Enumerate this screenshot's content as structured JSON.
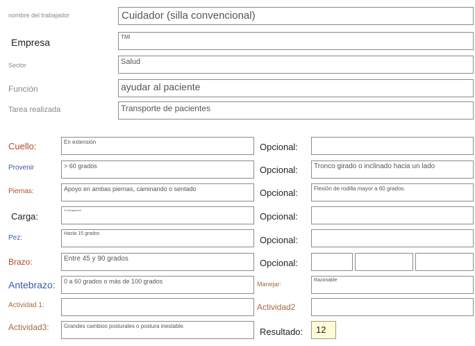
{
  "header": {
    "nombre": {
      "label": "nombre del trabajador",
      "value": "Cuidador (silla convencional)"
    },
    "empresa": {
      "label": "Empresa",
      "value": "TMI"
    },
    "sector": {
      "label": "Sector",
      "value": "Salud"
    },
    "funcion": {
      "label": "Función",
      "value": "ayudar al paciente"
    },
    "tarea": {
      "label": "Tarea realizada",
      "value": "Transporte de pacientes"
    }
  },
  "rows": {
    "cuello": {
      "label": "Cuello:",
      "value": "En extensión",
      "opt_label": "Opcional:",
      "opt_value": ""
    },
    "provenir": {
      "label": "Provenir",
      "value": "> 60 grados",
      "opt_label": "Opcional:",
      "opt_value": "Tronco girado o inclinado hacia un lado"
    },
    "piernas": {
      "label": "Piernas:",
      "value": "Apoyo en ambas piernas, caminando o sentado",
      "opt_label": "Opcional:",
      "opt_value": "Flexión de rodilla mayor a 60 grados."
    },
    "carga": {
      "label": "Carga:",
      "value": "10 kilogramos",
      "opt_label": "Opcional:",
      "opt_value": ""
    },
    "pez": {
      "label": "Pez:",
      "value": "Hasta 15 grados",
      "opt_label": "Opcional:",
      "opt_value": ""
    },
    "brazo": {
      "label": "Brazo:",
      "value": "Entre 45 y 90 grados",
      "opt_label": "Opcional:",
      "opt_values": [
        "",
        "",
        ""
      ]
    },
    "antebrazo": {
      "label": "Antebrazo:",
      "value": "0 a 60 grados o más de 100 grados",
      "opt_label": "Manejar:",
      "opt_value": "Razonable"
    },
    "actividad1": {
      "label": "Actividad 1:",
      "value": "",
      "opt_label": "Actividad2",
      "opt_value": ""
    },
    "actividad3": {
      "label": "Actividad3:",
      "value": "Grandes cambios posturales o postura inestable.",
      "opt_label": "Resultado:",
      "opt_value": "12"
    }
  }
}
